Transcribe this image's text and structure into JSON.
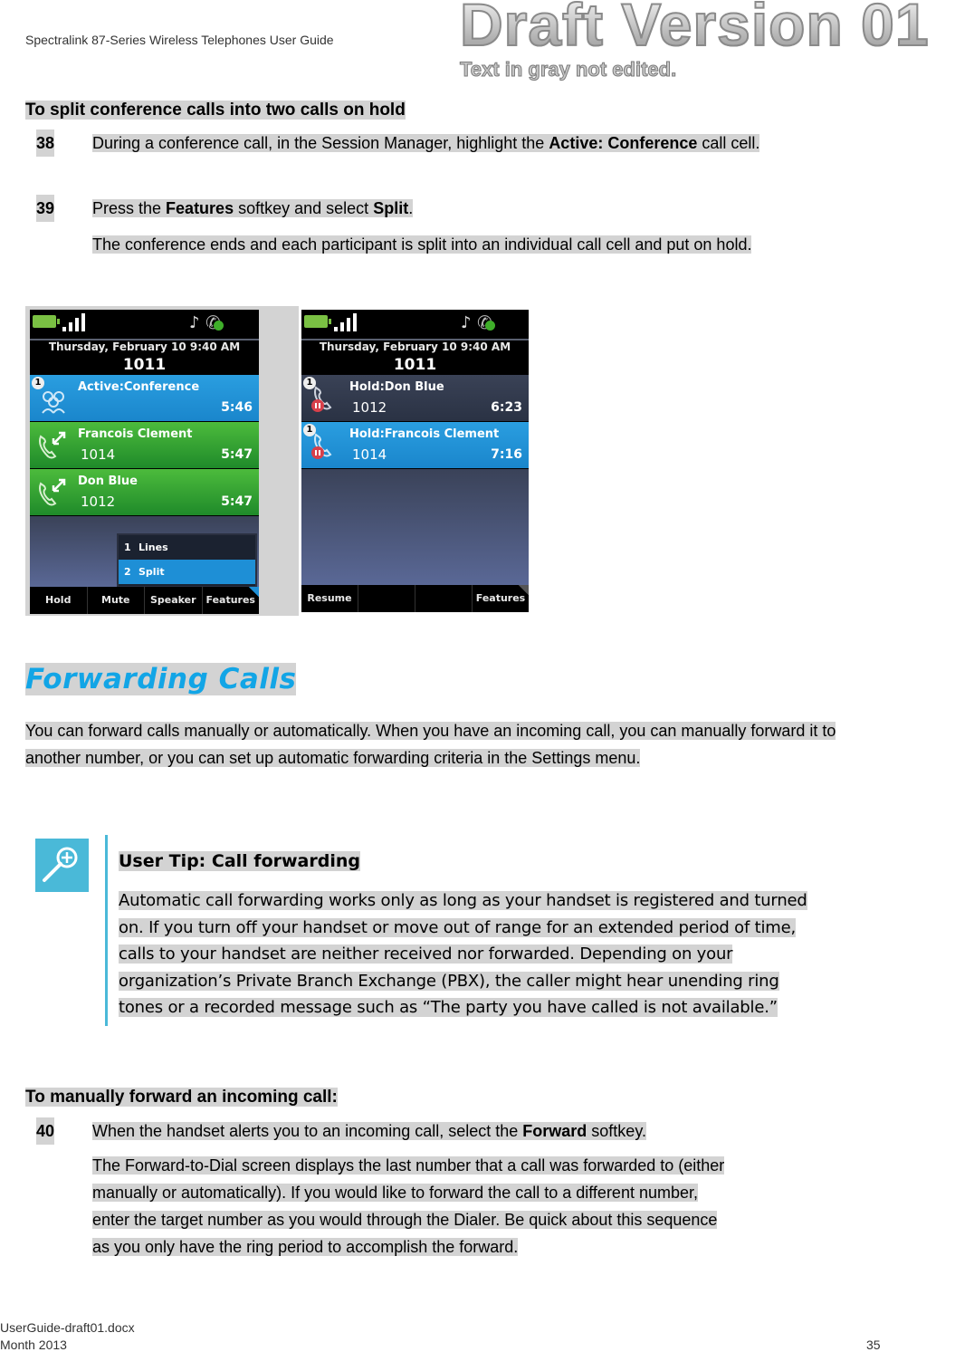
{
  "header": {
    "doc_title": "Spectralink 87-Series Wireless Telephones User Guide",
    "watermark": "Draft Version 01",
    "watermark_note": "Text in gray not edited."
  },
  "procedure1": {
    "title": "To split conference calls into two calls on hold",
    "steps": [
      {
        "number": "38",
        "text_before": "During a conference call, in the Session Manager, highlight the ",
        "bold": "Active: Conference",
        "text_after": " call cell."
      },
      {
        "number": "39",
        "text_before": "Press the ",
        "bold": "Features",
        "text_middle": " softkey and select ",
        "bold2": "Split",
        "text_after": ".",
        "result": "The conference ends and each participant is split into an individual call cell and put on hold."
      }
    ]
  },
  "phone_before": {
    "status_icons": [
      "battery-icon",
      "signal-icon",
      "ringer-icon",
      "registration-icon"
    ],
    "date": "Thursday, February 10 9:40 AM",
    "extension": "1011",
    "calls": [
      {
        "label": "Active:Conference",
        "number": "",
        "time": "5:46",
        "badge": "1",
        "state": "active-conference",
        "color": "#1e90d8"
      },
      {
        "label": "Francois Clement",
        "number": "1014",
        "time": "5:47",
        "badge": "",
        "state": "conference-member",
        "color": "#2f9e32"
      },
      {
        "label": "Don Blue",
        "number": "1012",
        "time": "5:47",
        "badge": "",
        "state": "conference-member",
        "color": "#2f9e32"
      }
    ],
    "menu": [
      {
        "n": "1",
        "label": "Lines",
        "selected": false
      },
      {
        "n": "2",
        "label": "Split",
        "selected": true
      }
    ],
    "softkeys": [
      "Hold",
      "Mute",
      "Speaker",
      "Features"
    ]
  },
  "phone_after": {
    "status_icons": [
      "battery-icon",
      "signal-icon",
      "ringer-icon",
      "registration-icon"
    ],
    "date": "Thursday, February 10 9:40 AM",
    "extension": "1011",
    "calls": [
      {
        "label": "Hold:Don Blue",
        "number": "1012",
        "time": "6:23",
        "badge": "1",
        "state": "hold",
        "color": "#2e3649"
      },
      {
        "label": "Hold:Francois Clement",
        "number": "1014",
        "time": "7:16",
        "badge": "1",
        "state": "hold",
        "color": "#1e90d8"
      }
    ],
    "softkeys": [
      "Resume",
      "",
      "",
      "Features"
    ]
  },
  "section": {
    "heading": "Forwarding Calls",
    "heading_color": "#12a5e6",
    "intro": "You can forward calls manually or automatically. When you have an incoming call, you can manually forward it to another number, or you can set up automatic forwarding criteria in the Settings menu."
  },
  "tip": {
    "icon": "magnifier-plus-icon",
    "title": "User Tip: Call forwarding",
    "lines": [
      "Automatic call forwarding works only as long as your handset is registered and turned",
      "on. If you turn off your handset or move out of range for an extended period of time,",
      "calls to your handset are neither received nor forwarded. Depending on your",
      "organization’s Private Branch Exchange (PBX), the caller might hear unending ring",
      "tones or a recorded message such as “The party you have called is not available.”"
    ]
  },
  "procedure2": {
    "title": "To manually forward an incoming call:",
    "steps": [
      {
        "number": "40",
        "text_before": "When the handset alerts you to an incoming call, select the ",
        "bold": "Forward",
        "text_after": " softkey.",
        "result_lines": [
          "The Forward-to-Dial screen displays the last number that a call was forwarded to (either",
          "manually or automatically). If you would like to forward the call to a different number,",
          "enter the target number as you would through the Dialer. Be quick about this sequence",
          "as you only have the ring period to accomplish the forward."
        ]
      }
    ]
  },
  "footer": {
    "filename": "UserGuide-draft01.docx",
    "date": "Month 2013",
    "page_number": "35"
  }
}
